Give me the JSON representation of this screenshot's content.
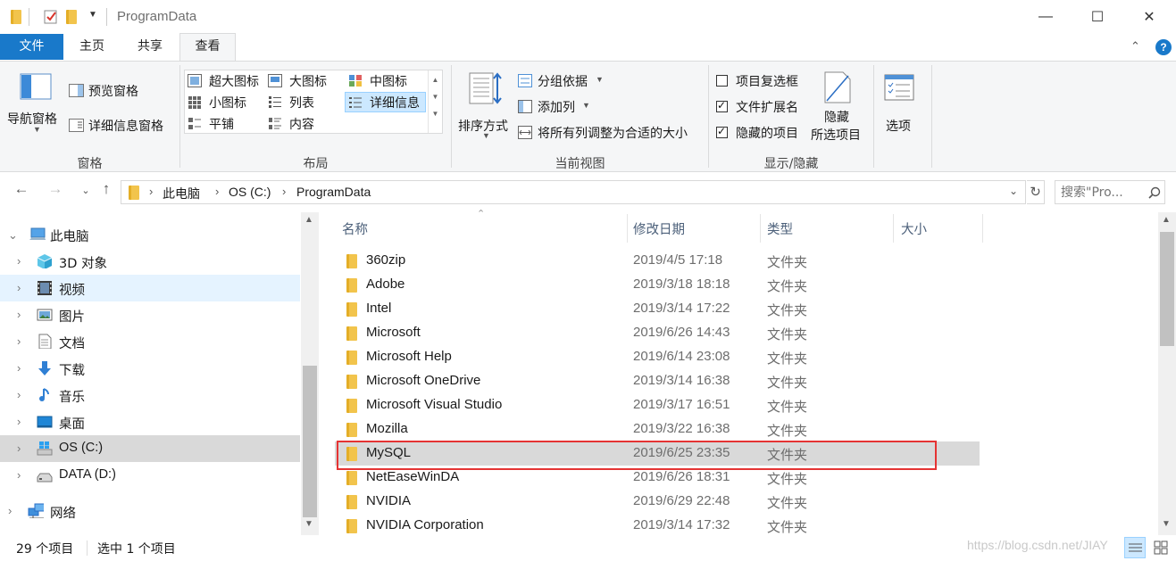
{
  "window": {
    "title": "ProgramData",
    "minimize_glyph": "—",
    "maximize_glyph": "☐",
    "close_glyph": "✕"
  },
  "tabs": [
    {
      "label": "文件"
    },
    {
      "label": "主页"
    },
    {
      "label": "共享"
    },
    {
      "label": "查看"
    }
  ],
  "ribbon": {
    "panes": {
      "nav_pane": "导航窗格",
      "preview_pane": "预览窗格",
      "details_pane": "详细信息窗格",
      "group": "窗格"
    },
    "layout": {
      "items": [
        "超大图标",
        "大图标",
        "中图标",
        "小图标",
        "列表",
        "详细信息",
        "平铺",
        "内容"
      ],
      "group": "布局"
    },
    "current_view": {
      "sort_by": "排序方式",
      "group_by": "分组依据",
      "add_columns": "添加列",
      "size_columns": "将所有列调整为合适的大小",
      "group": "当前视图"
    },
    "show_hide": {
      "item_checkboxes": "项目复选框",
      "file_extensions": "文件扩展名",
      "hidden_items": "隐藏的项目",
      "hide_line1": "隐藏",
      "hide_line2": "所选项目",
      "group": "显示/隐藏",
      "checkbox_states": {
        "item_checkboxes": false,
        "file_extensions": true,
        "hidden_items": true
      }
    },
    "options": "选项"
  },
  "address": {
    "crumbs": [
      "此电脑",
      "OS (C:)",
      "ProgramData"
    ],
    "search_placeholder": "搜索\"Pro..."
  },
  "nav": [
    {
      "label": "此电脑",
      "icon": "pc-icon",
      "state": "normal"
    },
    {
      "label": "3D 对象",
      "icon": "cube-icon",
      "state": "normal"
    },
    {
      "label": "视频",
      "icon": "video-icon",
      "state": "hover"
    },
    {
      "label": "图片",
      "icon": "pictures-icon",
      "state": "normal"
    },
    {
      "label": "文档",
      "icon": "documents-icon",
      "state": "normal"
    },
    {
      "label": "下载",
      "icon": "download-icon",
      "state": "normal"
    },
    {
      "label": "音乐",
      "icon": "music-icon",
      "state": "normal"
    },
    {
      "label": "桌面",
      "icon": "desktop-icon",
      "state": "normal"
    },
    {
      "label": "OS (C:)",
      "icon": "windows-drive-icon",
      "state": "selected"
    },
    {
      "label": "DATA (D:)",
      "icon": "drive-icon",
      "state": "normal"
    },
    {
      "label": "网络",
      "icon": "network-icon",
      "state": "normal"
    }
  ],
  "columns": {
    "name": "名称",
    "modified": "修改日期",
    "type": "类型",
    "size": "大小"
  },
  "files": [
    {
      "name": "360zip",
      "modified": "2019/4/5 17:18",
      "type": "文件夹"
    },
    {
      "name": "Adobe",
      "modified": "2019/3/18 18:18",
      "type": "文件夹"
    },
    {
      "name": "Intel",
      "modified": "2019/3/14 17:22",
      "type": "文件夹"
    },
    {
      "name": "Microsoft",
      "modified": "2019/6/26 14:43",
      "type": "文件夹"
    },
    {
      "name": "Microsoft Help",
      "modified": "2019/6/14 23:08",
      "type": "文件夹"
    },
    {
      "name": "Microsoft OneDrive",
      "modified": "2019/3/14 16:38",
      "type": "文件夹"
    },
    {
      "name": "Microsoft Visual Studio",
      "modified": "2019/3/17 16:51",
      "type": "文件夹"
    },
    {
      "name": "Mozilla",
      "modified": "2019/3/22 16:38",
      "type": "文件夹"
    },
    {
      "name": "MySQL",
      "modified": "2019/6/25 23:35",
      "type": "文件夹",
      "selected": true
    },
    {
      "name": "NetEaseWinDA",
      "modified": "2019/6/26 18:31",
      "type": "文件夹"
    },
    {
      "name": "NVIDIA",
      "modified": "2019/6/29 22:48",
      "type": "文件夹"
    },
    {
      "name": "NVIDIA Corporation",
      "modified": "2019/3/14 17:32",
      "type": "文件夹"
    }
  ],
  "status": {
    "count": "29 个项目",
    "selected": "选中 1 个项目"
  },
  "watermark": "https://blog.csdn.net/JIAY",
  "colors": {
    "accent": "#1979ca",
    "highlight_box": "#e53333",
    "selection": "#cce8ff",
    "row_selected": "#d9d9d9"
  }
}
